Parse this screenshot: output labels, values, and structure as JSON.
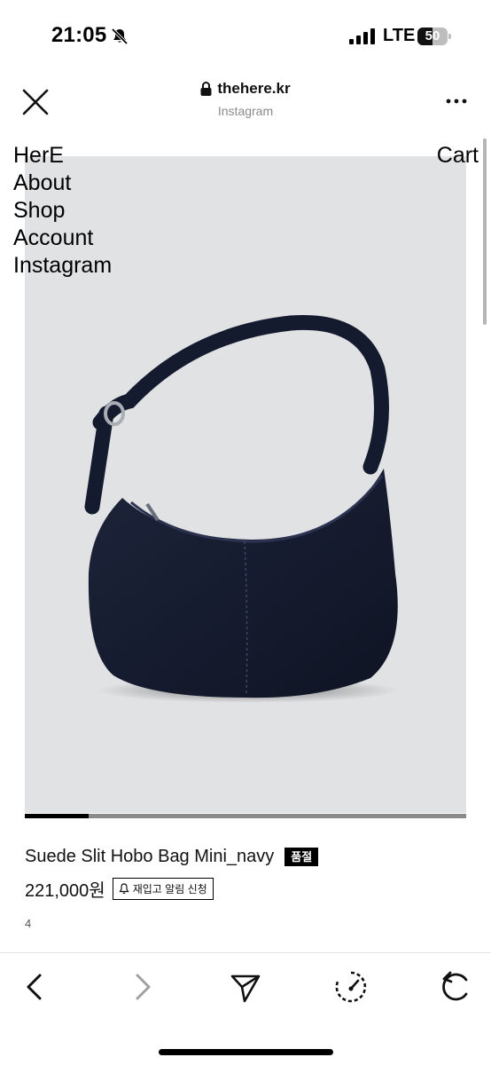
{
  "status_bar": {
    "time": "21:05",
    "network": "LTE",
    "battery_percent": "50",
    "battery_level": 0.5,
    "icons": [
      "bell-slash-icon",
      "signal-bars-icon",
      "battery-icon"
    ]
  },
  "browser": {
    "domain": "thehere.kr",
    "subtitle": "Instagram",
    "icons": [
      "close-icon",
      "lock-icon",
      "more-icon"
    ]
  },
  "site_nav": {
    "items": [
      "HerE",
      "About",
      "Shop",
      "Account",
      "Instagram"
    ],
    "cart": "Cart"
  },
  "carousel": {
    "progress": 0.145
  },
  "product": {
    "name": "Suede Slit Hobo Bag Mini_navy",
    "soldout_label": "품절",
    "price": "221,000원",
    "restock_label": "재입고 알림 신청",
    "stock": "4"
  },
  "toolbar": {
    "icons": [
      "back-arrow-icon",
      "forward-arrow-icon",
      "share-send-icon",
      "speed-gauge-icon",
      "reload-icon"
    ],
    "forward_enabled": false
  },
  "colors": {
    "image_background": "#e1e2e4",
    "bag": "#151b2e",
    "badge": "#000000"
  }
}
